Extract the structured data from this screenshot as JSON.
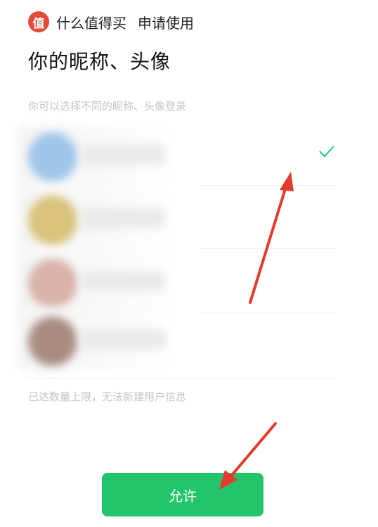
{
  "header": {
    "logo_char": "值",
    "app_name": "什么值得买",
    "request_text": "申请使用"
  },
  "title": "你的昵称、头像",
  "subtitle": "你可以选择不同的昵称、头像登录",
  "accounts": [
    {
      "selected": true,
      "avatar_color": "#9ec5ea"
    },
    {
      "selected": false,
      "avatar_color": "#d9c27a"
    },
    {
      "selected": false,
      "avatar_color": "#d9b2a8"
    },
    {
      "selected": false,
      "avatar_color": "#a88c80"
    }
  ],
  "limit_text": "已达数量上限，无法新建用户信息",
  "allow_button": "允许",
  "colors": {
    "brand_red": "#e4493a",
    "accent_green": "#24c46b",
    "arrow_red": "#e53b2e"
  }
}
